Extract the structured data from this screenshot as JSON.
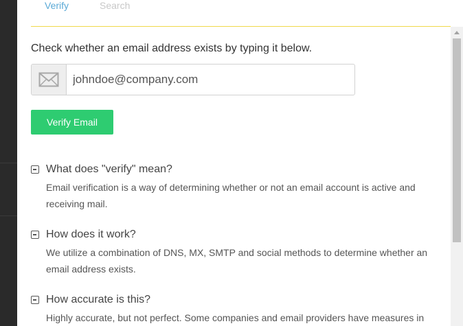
{
  "tabs": {
    "verify": "Verify",
    "search": "Search"
  },
  "intro": "Check whether an email address exists by typing it below.",
  "email": {
    "placeholder": "johndoe@company.com",
    "value": ""
  },
  "verify_button": "Verify Email",
  "faq": [
    {
      "question": "What does \"verify\" mean?",
      "answer": "Email verification is a way of determining whether or not an email account is active and receiving mail."
    },
    {
      "question": "How does it work?",
      "answer": "We utilize a combination of DNS, MX, SMTP and social methods to determine whether an email address exists."
    },
    {
      "question": "How accurate is this?",
      "answer": "Highly accurate, but not perfect. Some companies and email providers have measures in"
    }
  ],
  "colors": {
    "accent_tab": "#5aa9d6",
    "button": "#2ecc71",
    "rule": "#f0d94a"
  },
  "icons": {
    "email_addon": "envelope-icon",
    "faq_toggle": "collapse-minus-icon"
  }
}
